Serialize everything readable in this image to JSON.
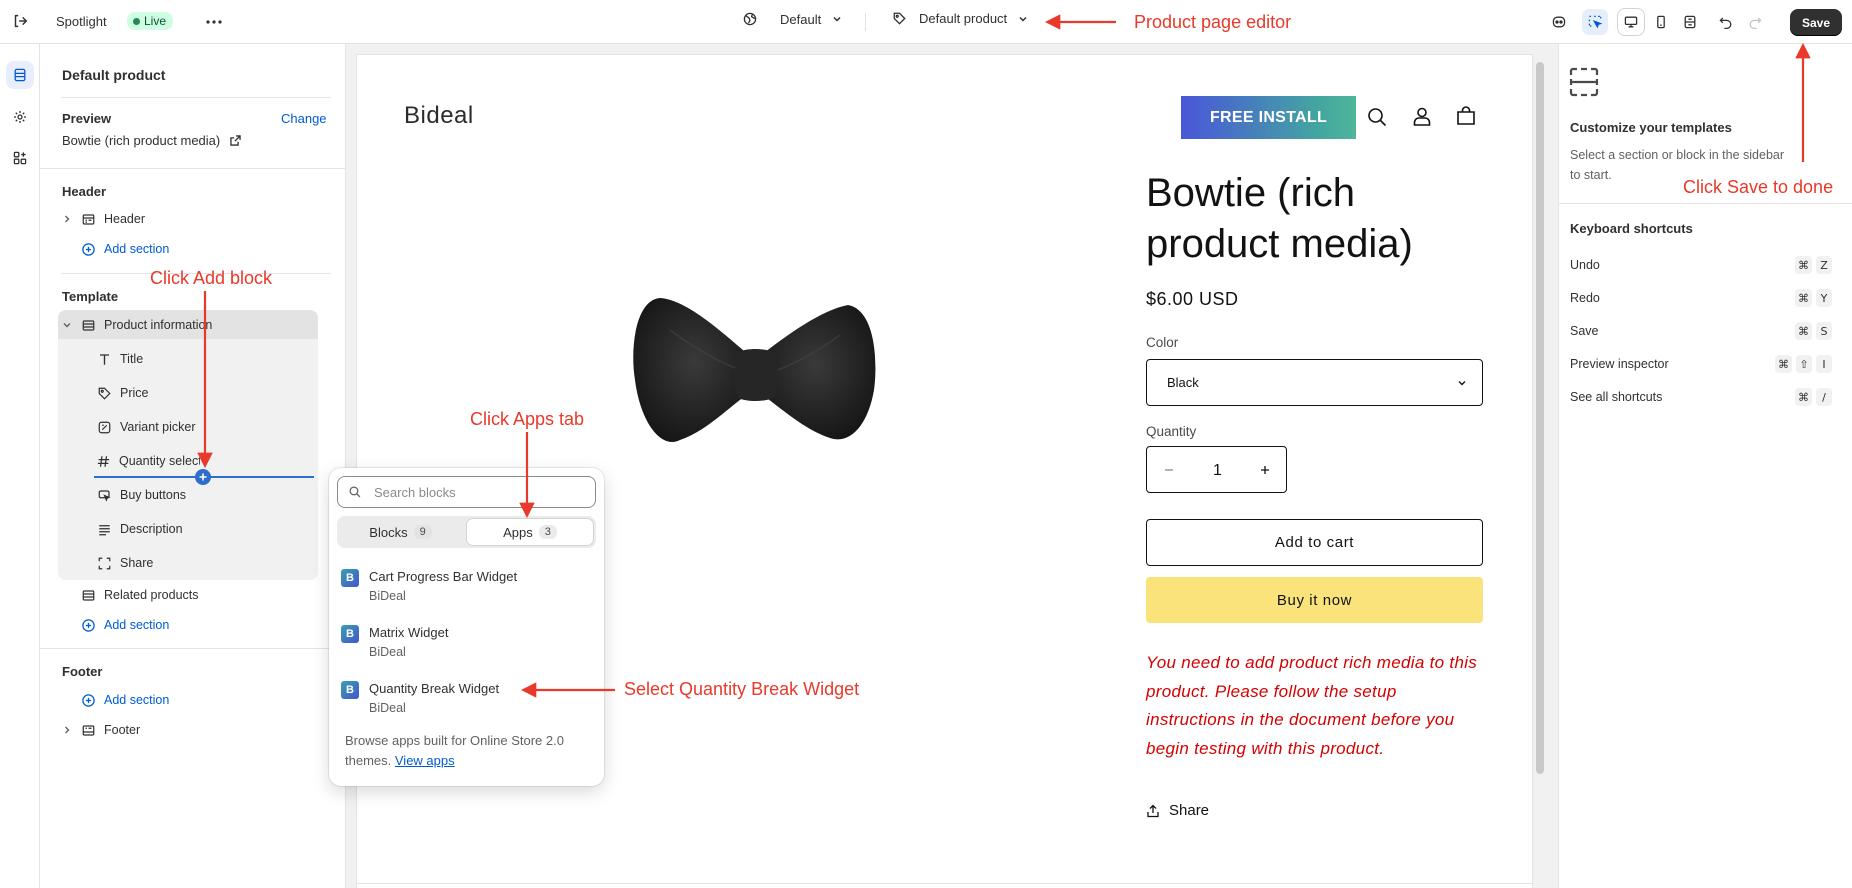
{
  "topbar": {
    "app_name": "Spotlight",
    "live_badge": "Live",
    "theme_selector": "Default",
    "template_selector": "Default product",
    "save_label": "Save"
  },
  "sidebar": {
    "title": "Default product",
    "preview_label": "Preview",
    "change_link": "Change",
    "preview_product": "Bowtie (rich product media)",
    "header_group": "Header",
    "header_item": "Header",
    "add_section": "Add section",
    "template_group": "Template",
    "product_information": "Product information",
    "blocks": [
      "Title",
      "Price",
      "Variant picker",
      "Quantity selector",
      "Buy buttons",
      "Description",
      "Share"
    ],
    "related_products": "Related products",
    "footer_group": "Footer",
    "footer_item": "Footer"
  },
  "popup": {
    "search_placeholder": "Search blocks",
    "tabs": [
      {
        "label": "Blocks",
        "count": "9"
      },
      {
        "label": "Apps",
        "count": "3"
      }
    ],
    "apps": [
      {
        "name": "Cart Progress Bar Widget",
        "vendor": "BiDeal"
      },
      {
        "name": "Matrix Widget",
        "vendor": "BiDeal"
      },
      {
        "name": "Quantity Break Widget",
        "vendor": "BiDeal"
      }
    ],
    "footer_text": "Browse apps built for Online Store 2.0 themes.",
    "view_apps_link": "View apps",
    "app_logo_letter": "B"
  },
  "store": {
    "logo": "Bideal",
    "free_install": "FREE INSTALL",
    "product_title_line1": "Bowtie (rich",
    "product_title_line2": "product media)",
    "price": "$6.00 USD",
    "color_label": "Color",
    "color_value": "Black",
    "quantity_label": "Quantity",
    "quantity_value": "1",
    "add_to_cart": "Add to cart",
    "buy_now": "Buy it now",
    "notice": "You need to add product rich media to this product. Please follow the setup instructions in the document before you begin testing with this product.",
    "share": "Share"
  },
  "right_panel": {
    "customize_title": "Customize your templates",
    "customize_desc": "Select a section or block in the sidebar to start.",
    "shortcuts_title": "Keyboard shortcuts",
    "shortcuts": [
      {
        "label": "Undo",
        "keys": [
          "⌘",
          "Z"
        ]
      },
      {
        "label": "Redo",
        "keys": [
          "⌘",
          "Y"
        ]
      },
      {
        "label": "Save",
        "keys": [
          "⌘",
          "S"
        ]
      },
      {
        "label": "Preview inspector",
        "keys": [
          "⌘",
          "⇧",
          "I"
        ]
      },
      {
        "label": "See all shortcuts",
        "keys": [
          "⌘",
          "/"
        ]
      }
    ]
  },
  "annotations": {
    "product_page_editor": "Product page editor",
    "click_save": "Click Save to done",
    "click_add_block": "Click Add block",
    "click_apps_tab": "Click Apps tab",
    "select_qb": "Select Quantity Break Widget"
  },
  "colors": {
    "accent": "#005bd3",
    "annotation": "#e8392a",
    "buy_now": "#fbe37b",
    "notice": "#d50000"
  }
}
